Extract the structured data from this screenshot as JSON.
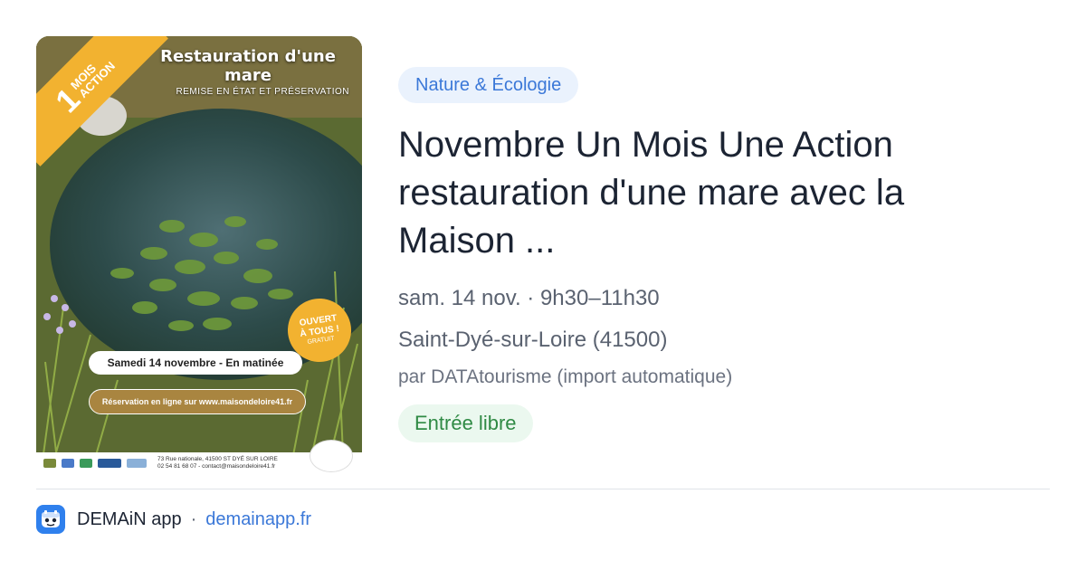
{
  "poster": {
    "title": "Restauration d'une mare",
    "subtitle": "REMISE EN ÉTAT ET PRÉSERVATION",
    "ribbon_number": "1",
    "ribbon_line1": "MOIS",
    "ribbon_line2": "ACTION",
    "badge_line1": "OUVERT",
    "badge_line2": "À TOUS !",
    "badge_line3": "GRATUIT",
    "date_text": "Samedi 14 novembre - En matinée",
    "reservation_text": "Réservation en ligne sur www.maisondeloire41.fr",
    "address_line1": "73 Rue nationale, 41500 ST DYÉ SUR LOIRE",
    "address_line2": "02 54 81 68 07 - contact@maisondeloire41.fr"
  },
  "event": {
    "category": "Nature & Écologie",
    "title": "Novembre Un Mois Une Action restauration d'une mare avec la Maison ...",
    "datetime": "sam. 14 nov. · 9h30–11h30",
    "location": "Saint-Dyé-sur-Loire (41500)",
    "source": "par DATAtourisme (import automatique)",
    "price": "Entrée libre"
  },
  "footer": {
    "app_name": "DEMAiN app",
    "separator": "·",
    "domain": "demainapp.fr"
  },
  "colors": {
    "accent_blue": "#3b78d8",
    "category_bg": "#eaf2fd",
    "price_green": "#2f8a44",
    "price_bg": "#ebf8ef",
    "title_text": "#1c2433",
    "muted_text": "#5a6270",
    "poster_orange": "#f2b230"
  },
  "icons": {
    "app_logo": "demain-app-logo-icon"
  }
}
